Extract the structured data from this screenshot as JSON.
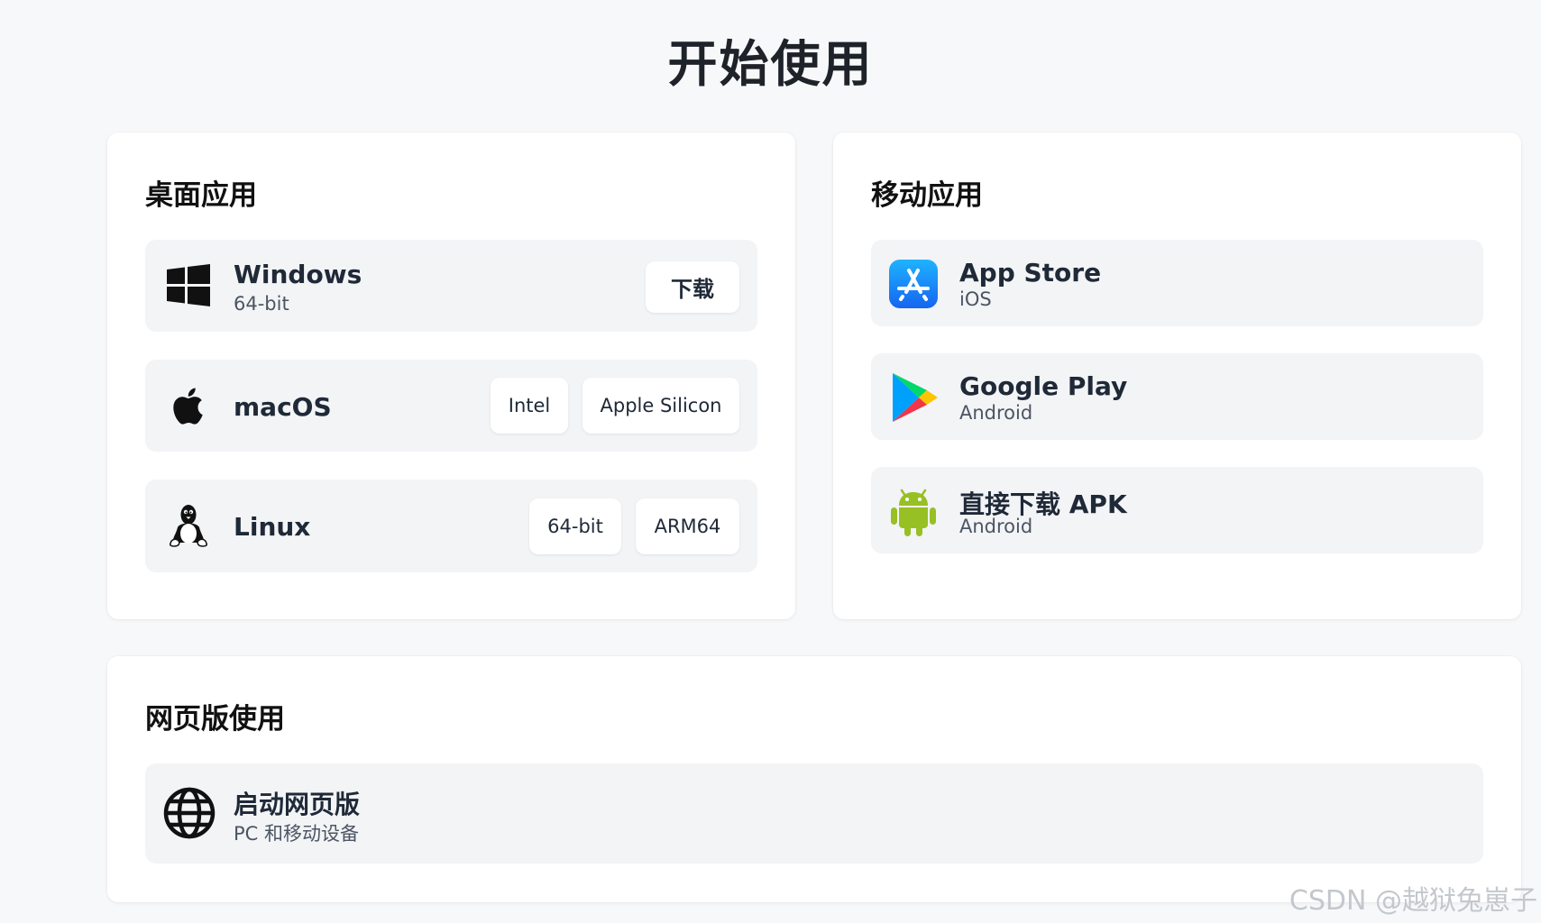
{
  "page": {
    "title": "开始使用"
  },
  "desktop": {
    "title": "桌面应用",
    "windows": {
      "name": "Windows",
      "sub": "64-bit",
      "icon": "windows-icon",
      "download_label": "下载"
    },
    "macos": {
      "name": "macOS",
      "icon": "apple-icon",
      "buttons": [
        "Intel",
        "Apple Silicon"
      ]
    },
    "linux": {
      "name": "Linux",
      "icon": "linux-tux-icon",
      "buttons": [
        "64-bit",
        "ARM64"
      ]
    }
  },
  "mobile": {
    "title": "移动应用",
    "items": [
      {
        "name": "App Store",
        "sub": "iOS",
        "icon": "app-store-icon"
      },
      {
        "name": "Google Play",
        "sub": "Android",
        "icon": "google-play-icon"
      },
      {
        "name": "直接下载 APK",
        "sub": "Android",
        "icon": "android-icon"
      }
    ]
  },
  "web": {
    "title": "网页版使用",
    "launch": {
      "name": "启动网页版",
      "sub": "PC 和移动设备",
      "icon": "globe-icon"
    }
  },
  "watermark": "CSDN @越狱兔崽子",
  "colors": {
    "background": "#f7f8fa",
    "card": "#ffffff",
    "row": "#f3f4f6",
    "android_green": "#97c024",
    "app_store_blue": "#1a8cff"
  }
}
